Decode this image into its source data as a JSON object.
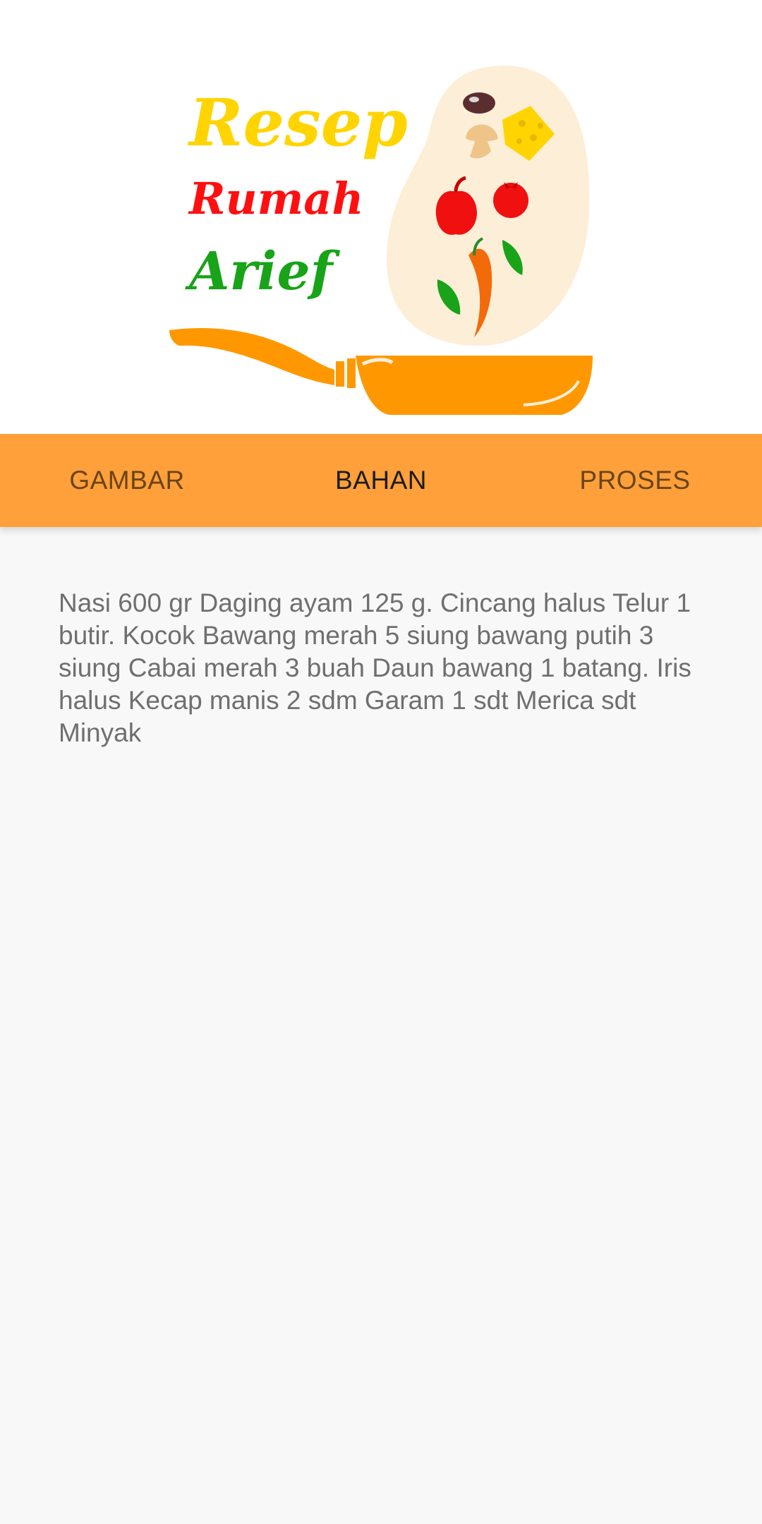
{
  "logo": {
    "word1": "Resep",
    "word2": "Rumah",
    "word3": "Arief",
    "colors": {
      "word1": "#ffd400",
      "word2": "#ff0f0f",
      "word3": "#18a318",
      "pan": "#ff9800",
      "blob": "#fdeed8"
    }
  },
  "tabs": [
    {
      "label": "GAMBAR",
      "active": false
    },
    {
      "label": "BAHAN",
      "active": true
    },
    {
      "label": "PROSES",
      "active": false
    }
  ],
  "content": {
    "text": "Nasi 600 gr Daging ayam 125 g. Cincang halus Telur 1 butir. Kocok Bawang merah 5 siung bawang putih 3 siung Cabai merah 3 buah Daun bawang 1 batang. Iris halus Kecap manis 2 sdm Garam 1 sdt Merica sdt Minyak"
  },
  "colors": {
    "tabbar": "#ffa03a",
    "tab_inactive": "#6a4418",
    "tab_active": "#1c1c1c",
    "background": "#f8f8f8",
    "body_text": "#6f6f6f"
  }
}
